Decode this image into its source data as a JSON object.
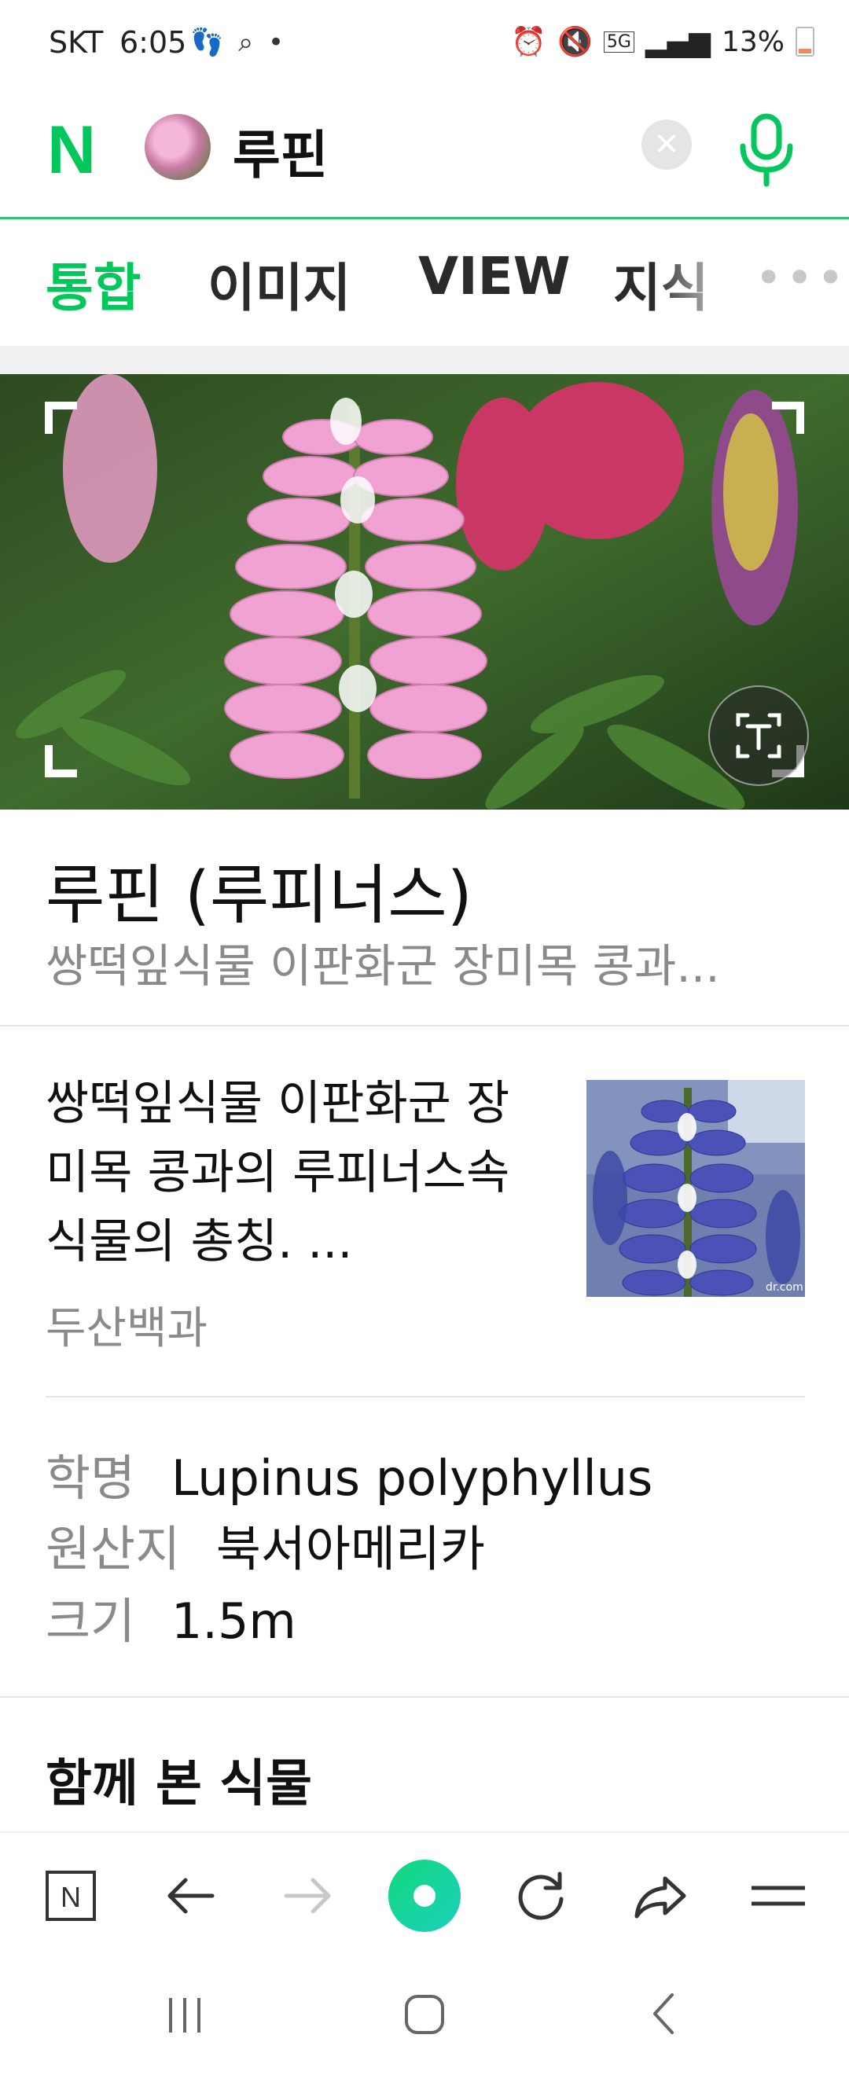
{
  "status_bar": {
    "carrier": "SKT",
    "time": "6:05",
    "notification_icons": [
      "footprints-icon",
      "search-icon",
      "dot-icon"
    ],
    "right_icons": [
      "alarm-icon",
      "mute-icon",
      "5g-icon",
      "signal-icon"
    ],
    "network_label": "5G",
    "battery": "13%"
  },
  "search": {
    "logo": "N",
    "query": "루핀"
  },
  "tabs": [
    {
      "label": "통합",
      "active": true
    },
    {
      "label": "이미지",
      "active": false
    },
    {
      "label": "VIEW",
      "active": false
    },
    {
      "label": "지식",
      "active": false
    }
  ],
  "tabs_more": "•••",
  "result": {
    "title": "루핀 (루피너스)",
    "subtitle": "쌍떡잎식물 이판화군 장미목 콩과...",
    "description": "쌍떡잎식물 이판화군 장미목 콩과의 루피너스속 식물의 총칭. ...",
    "source": "두산백과",
    "thumb_caption": "dr.com",
    "info": [
      {
        "key": "학명",
        "value": "Lupinus polyphyllus"
      },
      {
        "key": "원산지",
        "value": "북서아메리카"
      },
      {
        "key": "크기",
        "value": "1.5m"
      }
    ],
    "related_heading": "함께 본 식물"
  },
  "browser_nav": {
    "home_label": "N",
    "icons": [
      "naver-home-icon",
      "back-arrow-icon",
      "forward-arrow-icon",
      "green-dot-icon",
      "reload-icon",
      "share-icon",
      "menu-icon"
    ]
  },
  "colors": {
    "brand": "#03c75a",
    "muted": "#8a8a8a"
  }
}
